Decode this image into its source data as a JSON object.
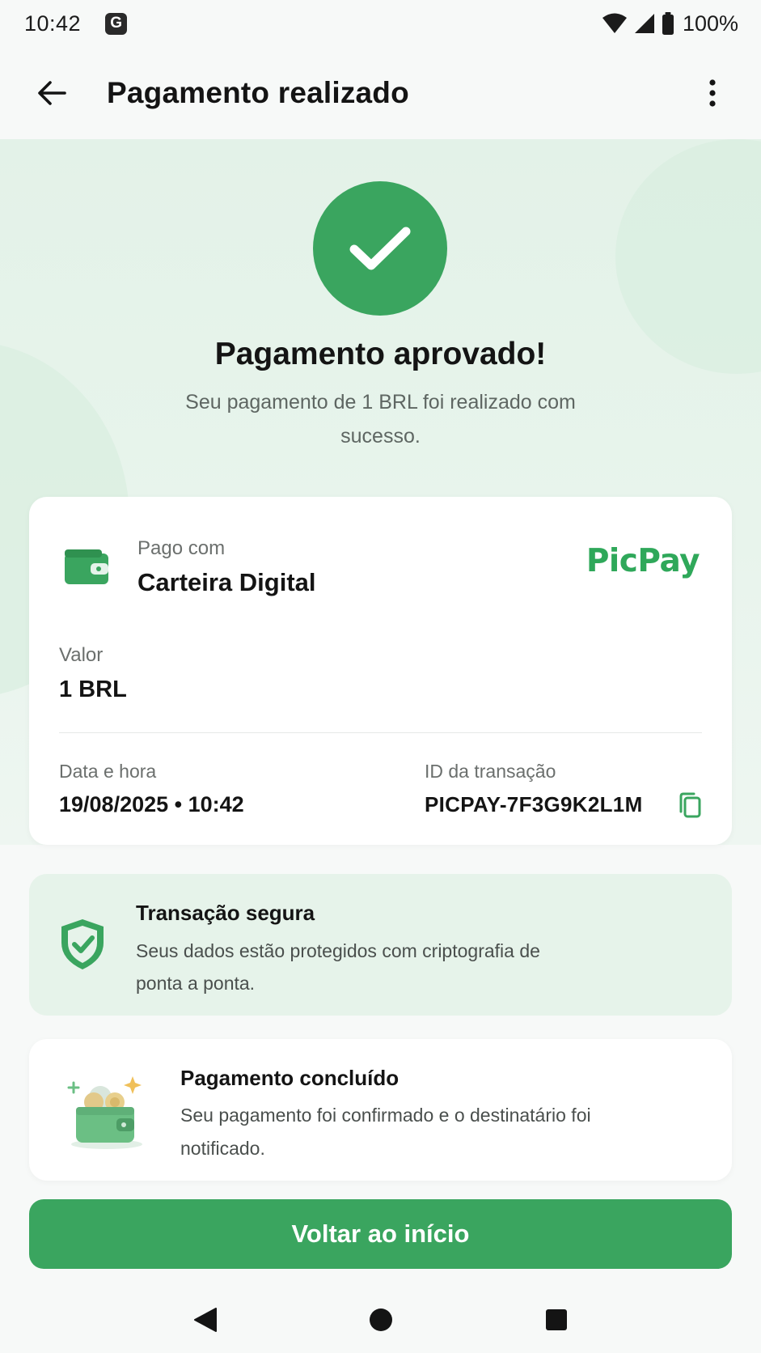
{
  "status_bar": {
    "time": "10:42",
    "notification_badge": "G",
    "battery": "100%",
    "icons": [
      "wifi-icon",
      "signal-icon",
      "battery-icon"
    ]
  },
  "app_bar": {
    "title": "Pagamento realizado",
    "back_icon": "arrow-left-icon",
    "menu_icon": "more-vertical-icon"
  },
  "hero": {
    "icon": "check-icon",
    "title": "Pagamento aprovado!",
    "subtitle": "Seu pagamento de 1 BRL foi realizado com sucesso."
  },
  "payment_card": {
    "method_label": "Pago com",
    "method_value": "Carteira Digital",
    "brand": "PicPay",
    "amount_label": "Valor",
    "amount_value": "1 BRL",
    "datetime_label": "Data e hora",
    "datetime_value": "19/08/2025 • 10:42",
    "transaction_id_label": "ID da transação",
    "transaction_id_value": "PICPAY-7F3G9K2L1M"
  },
  "secure_card": {
    "title": "Transação segura",
    "text": "Seus dados estão protegidos com criptografia de ponta a ponta."
  },
  "done_card": {
    "title": "Pagamento concluído",
    "text": "Seu pagamento foi confirmado e o destinatário foi notificado."
  },
  "primary_button": {
    "label": "Voltar ao início"
  },
  "nav_bar": {
    "buttons": [
      "nav-back-icon",
      "nav-home-icon",
      "nav-recents-icon"
    ]
  },
  "colors": {
    "accent": "#3aa55f",
    "hero_bg": "#e3f2e8",
    "secure_bg": "#e6f3ea",
    "page_bg": "#f7f9f8"
  }
}
